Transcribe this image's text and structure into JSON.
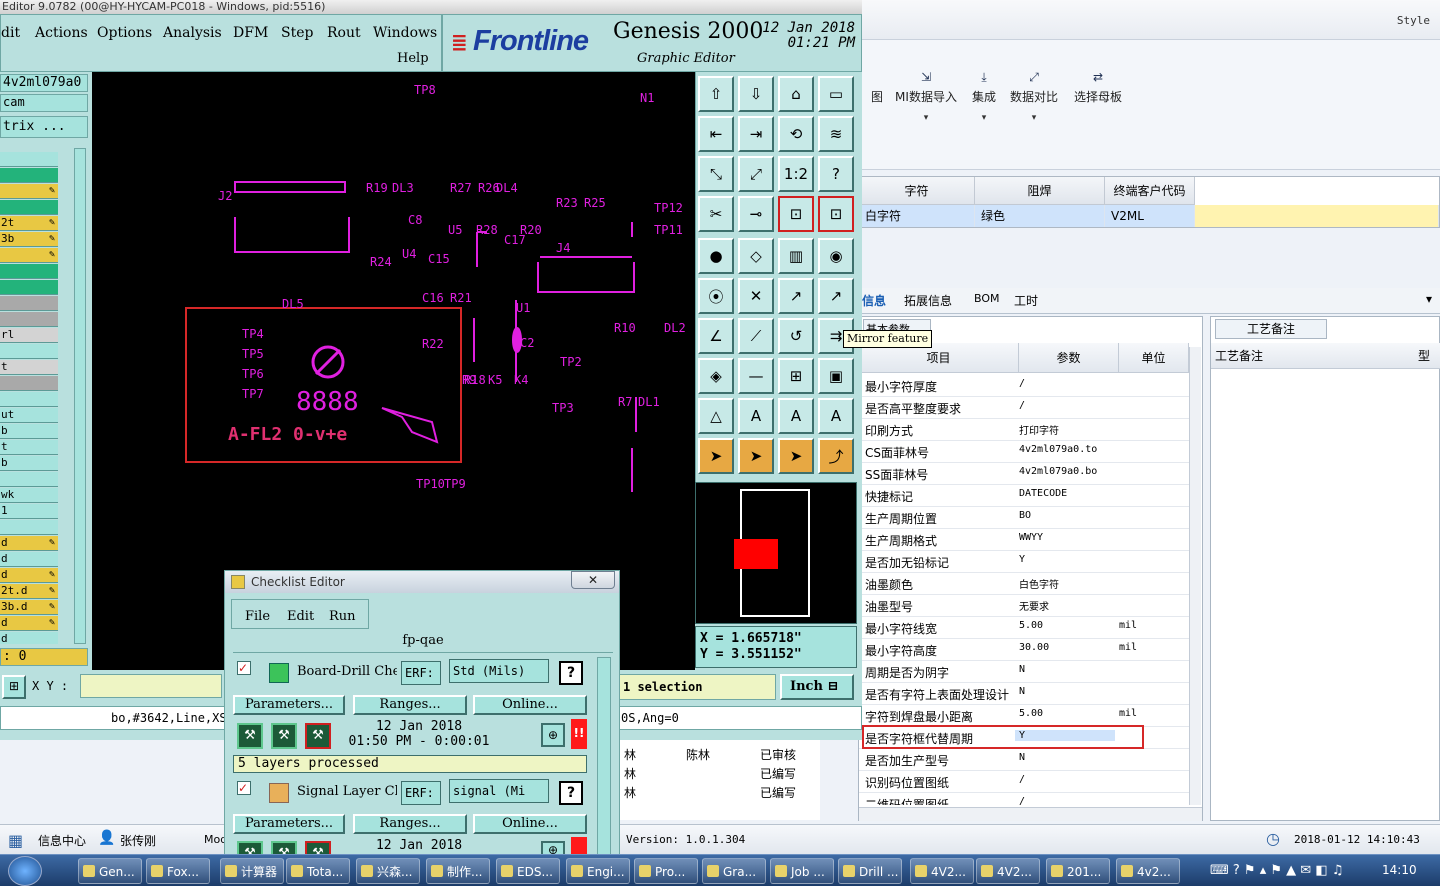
{
  "right_app": {
    "style_label": "Style",
    "ribbon": [
      {
        "label": "图",
        "icon": "doc-icon"
      },
      {
        "label": "MI数据导入",
        "icon": "import-icon"
      },
      {
        "label": "集成",
        "icon": "download-icon"
      },
      {
        "label": "数据对比",
        "icon": "compare-icon"
      },
      {
        "label": "选择母板",
        "icon": "shuffle-icon"
      }
    ],
    "grid_headers": [
      "字符",
      "阻焊",
      "终端客户代码"
    ],
    "grid_row": [
      "白字符",
      "绿色",
      "V2ML"
    ],
    "tabs": [
      "信息",
      "拓展信息",
      "BOM",
      "工时"
    ],
    "basic_params_tab": "基本参数",
    "param_headers": [
      "项目",
      "参数",
      "单位"
    ],
    "params": [
      {
        "item": "最小字符厚度",
        "value": "/",
        "unit": ""
      },
      {
        "item": "是否高平整度要求",
        "value": "/",
        "unit": ""
      },
      {
        "item": "印刷方式",
        "value": "打印字符",
        "unit": ""
      },
      {
        "item": "CS面菲林号",
        "value": "4v2ml079a0.to",
        "unit": ""
      },
      {
        "item": "SS面菲林号",
        "value": "4v2ml079a0.bo",
        "unit": ""
      },
      {
        "item": "快捷标记",
        "value": "DATECODE",
        "unit": ""
      },
      {
        "item": "生产周期位置",
        "value": "BO",
        "unit": ""
      },
      {
        "item": "生产周期格式",
        "value": "WWYY",
        "unit": ""
      },
      {
        "item": "是否加无铅标记",
        "value": "Y",
        "unit": ""
      },
      {
        "item": "油墨颜色",
        "value": "白色字符",
        "unit": ""
      },
      {
        "item": "油墨型号",
        "value": "无要求",
        "unit": ""
      },
      {
        "item": "最小字符线宽",
        "value": "5.00",
        "unit": "mil"
      },
      {
        "item": "最小字符高度",
        "value": "30.00",
        "unit": "mil"
      },
      {
        "item": "周期是否为阴字",
        "value": "N",
        "unit": ""
      },
      {
        "item": "是否有字符上表面处理设计",
        "value": "N",
        "unit": ""
      },
      {
        "item": "字符到焊盘最小距离",
        "value": "5.00",
        "unit": "mil"
      },
      {
        "item": "是否字符框代替周期",
        "value": "Y",
        "unit": ""
      },
      {
        "item": "是否加生产型号",
        "value": "N",
        "unit": ""
      },
      {
        "item": "识别码位置图纸",
        "value": "/",
        "unit": ""
      },
      {
        "item": "二维码位置图纸",
        "value": "/",
        "unit": ""
      }
    ],
    "notes_tab": "工艺备注",
    "notes_header": "工艺备注",
    "notes_col2": "型",
    "bottom_table": [
      [
        "林",
        "陈林",
        "已审核"
      ],
      [
        "林",
        "",
        "已编写"
      ],
      [
        "林",
        "",
        "已编写"
      ]
    ],
    "status": {
      "info_center": "信息中心",
      "user": "张传刚",
      "mod": "Mod",
      "version": "Version: 1.0.1.304",
      "datetime": "2018-01-12 14:10:43"
    }
  },
  "genesis": {
    "title": "Editor 9.0782 (00@HY-HYCAM-PC018 - Windows, pid:5516)",
    "menu": [
      "dit",
      "Actions",
      "Options",
      "Analysis",
      "DFM",
      "Step",
      "Rout",
      "Windows"
    ],
    "help": "Help",
    "brand": "Frontline",
    "product": "Genesis 2000",
    "subtitle": "Graphic Editor",
    "date": "12 Jan 2018",
    "time": "01:21 PM",
    "left": {
      "job": "4v2ml079a0",
      "step": "cam",
      "matrix": "trix ...",
      "zero": ": 0"
    },
    "layers": [
      "",
      "",
      "",
      "",
      "2t",
      "3b",
      "",
      "",
      "",
      "",
      "",
      "rl",
      "",
      "t",
      "",
      "",
      "ut",
      "b",
      "t",
      "b",
      "",
      "wk",
      "1",
      "",
      "d",
      "d",
      "d",
      "2t.d",
      "3b.d",
      "d",
      "d"
    ],
    "tooltip": "Mirror feature",
    "coords": {
      "x": "X = 1.665718\"",
      "y": "Y = 3.551152\""
    },
    "xy_label": "X Y :",
    "selection": "1 selection",
    "units": "Inch",
    "status_line": "bo,#3642,Line,XS",
    "status_right": "0S,Ang=0",
    "canvas_text": [
      "TP8",
      "TP9",
      "TP10",
      "DL4",
      "R23",
      "R25",
      "R26",
      "R27",
      "DL3",
      "R19",
      "C8",
      "U5",
      "R28",
      "R20",
      "C17",
      "U4",
      "C15",
      "R24",
      "J4",
      "C16",
      "R21",
      "U1",
      "C2",
      "R22",
      "TP2",
      "R18",
      "TP4",
      "TP5",
      "TP6",
      "TP7",
      "8888",
      "A-FL2 0-v+e",
      "DL2",
      "R10",
      "R9",
      "K5",
      "K4",
      "TP3",
      "R7",
      "DL1",
      "TP12",
      "TP11",
      "J2",
      "DL5",
      "N1"
    ]
  },
  "checklist": {
    "title": "Checklist Editor",
    "menu": [
      "File",
      "Edit",
      "Run"
    ],
    "name": "fp-qae",
    "items": [
      {
        "name": "Board-Drill Che",
        "erf": "ERF:",
        "std": "Std (Mils)",
        "help": "?",
        "params": "Parameters...",
        "ranges": "Ranges...",
        "online": "Online...",
        "date": "12 Jan 2018",
        "time": "01:50 PM - 0:00:01",
        "status": "5 layers processed"
      },
      {
        "name": "Signal Layer Ch",
        "erf": "ERF:",
        "std": "signal (Mi",
        "help": "?",
        "params": "Parameters...",
        "ranges": "Ranges...",
        "online": "Online...",
        "date": "12 Jan 2018",
        "time": "",
        "status": ""
      }
    ]
  },
  "taskbar": {
    "items": [
      "Gen...",
      "Fox...",
      "计算器",
      "Tota...",
      "兴森...",
      "制作...",
      "EDS...",
      "Engi...",
      "Pro...",
      "Gra...",
      "Job ...",
      "Drill ...",
      "4V2...",
      "4V2...",
      "201...",
      "4v2..."
    ],
    "clock": "14:10"
  }
}
